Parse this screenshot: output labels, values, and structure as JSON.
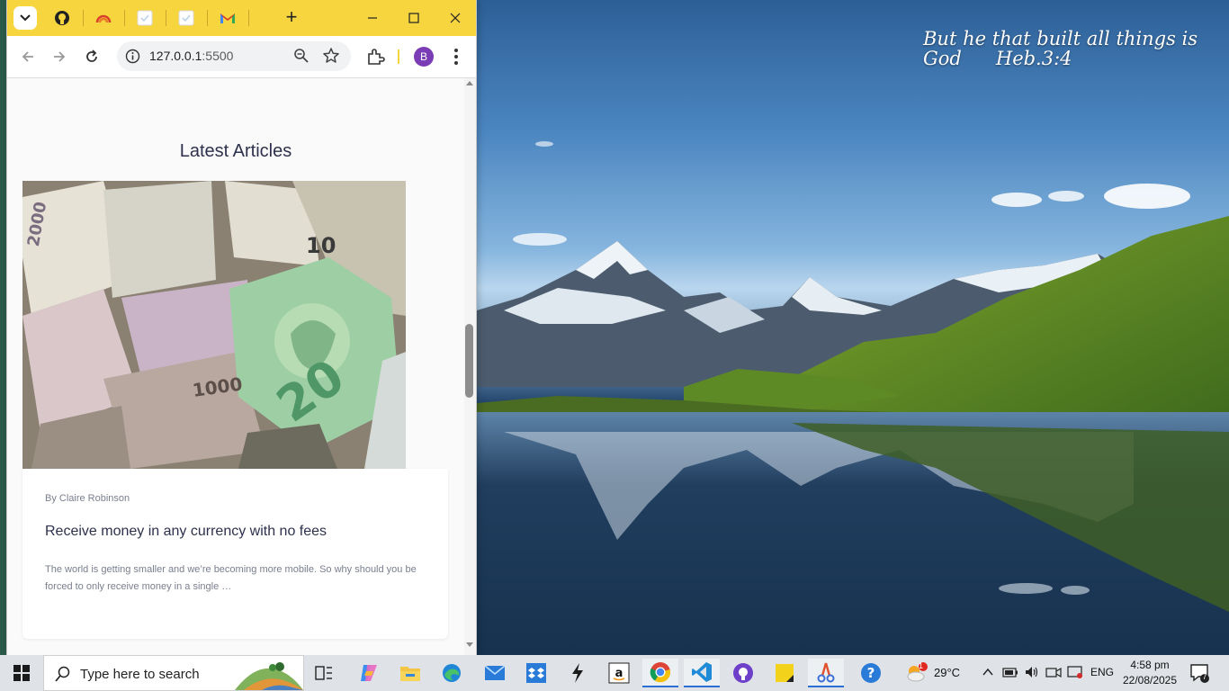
{
  "desktop": {
    "verse_line1": "But he that built all things is",
    "verse_word": "God",
    "verse_ref": "Heb.3:4"
  },
  "browser": {
    "tabs": [
      {
        "icon": "github-icon"
      },
      {
        "icon": "rainbow-icon"
      },
      {
        "icon": "page-icon"
      },
      {
        "icon": "page-icon"
      },
      {
        "icon": "gmail-icon"
      }
    ],
    "new_tab_label": "+",
    "url_host": "127.0.0.1",
    "url_port": ":5500",
    "profile_initial": "B",
    "accent": "#f7d53f"
  },
  "page": {
    "section_title": "Latest Articles",
    "article": {
      "author": "By Claire Robinson",
      "title": "Receive money in any currency with no fees",
      "excerpt": "The world is getting smaller and we’re becoming more mobile. So why should you be forced to only receive money in a single …",
      "banknote_value": "20"
    }
  },
  "taskbar": {
    "search_placeholder": "Type here to search",
    "weather_temp": "29°C",
    "language": "ENG",
    "time": "4:58 pm",
    "date": "22/08/2025",
    "weather_badge": "1",
    "notification_count": "7"
  }
}
